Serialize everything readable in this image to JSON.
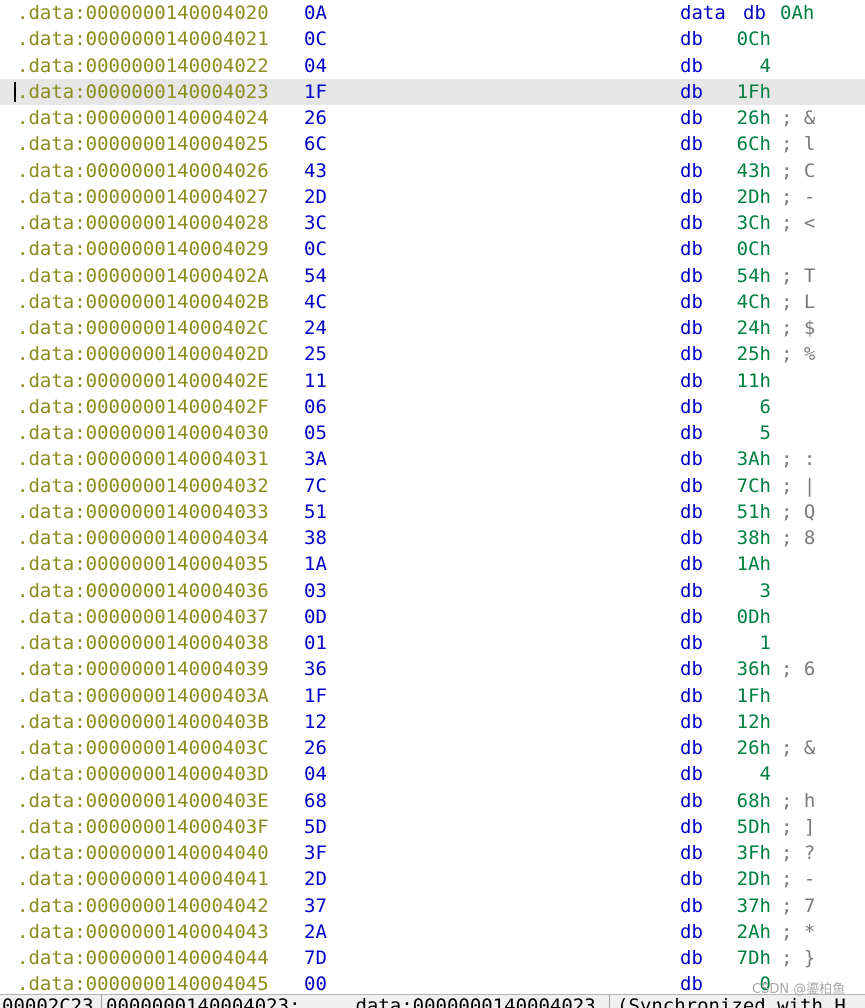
{
  "listing": {
    "selected_index": 3,
    "rows": [
      {
        "addr": ".data:0000000140004020",
        "hex": "0A",
        "label": "data",
        "directive": "db",
        "value": "0Ah",
        "comment": ""
      },
      {
        "addr": ".data:0000000140004021",
        "hex": "0C",
        "label": "",
        "directive": "db",
        "value": "0Ch",
        "comment": ""
      },
      {
        "addr": ".data:0000000140004022",
        "hex": "04",
        "label": "",
        "directive": "db",
        "value": "4",
        "comment": ""
      },
      {
        "addr": ".data:0000000140004023",
        "hex": "1F",
        "label": "",
        "directive": "db",
        "value": "1Fh",
        "comment": ""
      },
      {
        "addr": ".data:0000000140004024",
        "hex": "26",
        "label": "",
        "directive": "db",
        "value": "26h",
        "comment": "; &"
      },
      {
        "addr": ".data:0000000140004025",
        "hex": "6C",
        "label": "",
        "directive": "db",
        "value": "6Ch",
        "comment": "; l"
      },
      {
        "addr": ".data:0000000140004026",
        "hex": "43",
        "label": "",
        "directive": "db",
        "value": "43h",
        "comment": "; C"
      },
      {
        "addr": ".data:0000000140004027",
        "hex": "2D",
        "label": "",
        "directive": "db",
        "value": "2Dh",
        "comment": "; -"
      },
      {
        "addr": ".data:0000000140004028",
        "hex": "3C",
        "label": "",
        "directive": "db",
        "value": "3Ch",
        "comment": "; <"
      },
      {
        "addr": ".data:0000000140004029",
        "hex": "0C",
        "label": "",
        "directive": "db",
        "value": "0Ch",
        "comment": ""
      },
      {
        "addr": ".data:000000014000402A",
        "hex": "54",
        "label": "",
        "directive": "db",
        "value": "54h",
        "comment": "; T"
      },
      {
        "addr": ".data:000000014000402B",
        "hex": "4C",
        "label": "",
        "directive": "db",
        "value": "4Ch",
        "comment": "; L"
      },
      {
        "addr": ".data:000000014000402C",
        "hex": "24",
        "label": "",
        "directive": "db",
        "value": "24h",
        "comment": "; $"
      },
      {
        "addr": ".data:000000014000402D",
        "hex": "25",
        "label": "",
        "directive": "db",
        "value": "25h",
        "comment": "; %"
      },
      {
        "addr": ".data:000000014000402E",
        "hex": "11",
        "label": "",
        "directive": "db",
        "value": "11h",
        "comment": ""
      },
      {
        "addr": ".data:000000014000402F",
        "hex": "06",
        "label": "",
        "directive": "db",
        "value": "6",
        "comment": ""
      },
      {
        "addr": ".data:0000000140004030",
        "hex": "05",
        "label": "",
        "directive": "db",
        "value": "5",
        "comment": ""
      },
      {
        "addr": ".data:0000000140004031",
        "hex": "3A",
        "label": "",
        "directive": "db",
        "value": "3Ah",
        "comment": "; :"
      },
      {
        "addr": ".data:0000000140004032",
        "hex": "7C",
        "label": "",
        "directive": "db",
        "value": "7Ch",
        "comment": "; |"
      },
      {
        "addr": ".data:0000000140004033",
        "hex": "51",
        "label": "",
        "directive": "db",
        "value": "51h",
        "comment": "; Q"
      },
      {
        "addr": ".data:0000000140004034",
        "hex": "38",
        "label": "",
        "directive": "db",
        "value": "38h",
        "comment": "; 8"
      },
      {
        "addr": ".data:0000000140004035",
        "hex": "1A",
        "label": "",
        "directive": "db",
        "value": "1Ah",
        "comment": ""
      },
      {
        "addr": ".data:0000000140004036",
        "hex": "03",
        "label": "",
        "directive": "db",
        "value": "3",
        "comment": ""
      },
      {
        "addr": ".data:0000000140004037",
        "hex": "0D",
        "label": "",
        "directive": "db",
        "value": "0Dh",
        "comment": ""
      },
      {
        "addr": ".data:0000000140004038",
        "hex": "01",
        "label": "",
        "directive": "db",
        "value": "1",
        "comment": ""
      },
      {
        "addr": ".data:0000000140004039",
        "hex": "36",
        "label": "",
        "directive": "db",
        "value": "36h",
        "comment": "; 6"
      },
      {
        "addr": ".data:000000014000403A",
        "hex": "1F",
        "label": "",
        "directive": "db",
        "value": "1Fh",
        "comment": ""
      },
      {
        "addr": ".data:000000014000403B",
        "hex": "12",
        "label": "",
        "directive": "db",
        "value": "12h",
        "comment": ""
      },
      {
        "addr": ".data:000000014000403C",
        "hex": "26",
        "label": "",
        "directive": "db",
        "value": "26h",
        "comment": "; &"
      },
      {
        "addr": ".data:000000014000403D",
        "hex": "04",
        "label": "",
        "directive": "db",
        "value": "4",
        "comment": ""
      },
      {
        "addr": ".data:000000014000403E",
        "hex": "68",
        "label": "",
        "directive": "db",
        "value": "68h",
        "comment": "; h"
      },
      {
        "addr": ".data:000000014000403F",
        "hex": "5D",
        "label": "",
        "directive": "db",
        "value": "5Dh",
        "comment": "; ]"
      },
      {
        "addr": ".data:0000000140004040",
        "hex": "3F",
        "label": "",
        "directive": "db",
        "value": "3Fh",
        "comment": "; ?"
      },
      {
        "addr": ".data:0000000140004041",
        "hex": "2D",
        "label": "",
        "directive": "db",
        "value": "2Dh",
        "comment": "; -"
      },
      {
        "addr": ".data:0000000140004042",
        "hex": "37",
        "label": "",
        "directive": "db",
        "value": "37h",
        "comment": "; 7"
      },
      {
        "addr": ".data:0000000140004043",
        "hex": "2A",
        "label": "",
        "directive": "db",
        "value": "2Ah",
        "comment": "; *"
      },
      {
        "addr": ".data:0000000140004044",
        "hex": "7D",
        "label": "",
        "directive": "db",
        "value": "7Dh",
        "comment": "; }"
      },
      {
        "addr": ".data:0000000140004045",
        "hex": "00",
        "label": "",
        "directive": "db",
        "value": "0",
        "comment": ""
      }
    ]
  },
  "statusbar": {
    "file_offset": "00002C23",
    "address": "0000000140004023:",
    "location": ".data:0000000140004023",
    "sync": "(Synchronized with H"
  },
  "watermark": "CSDN @鎏柏鱼"
}
